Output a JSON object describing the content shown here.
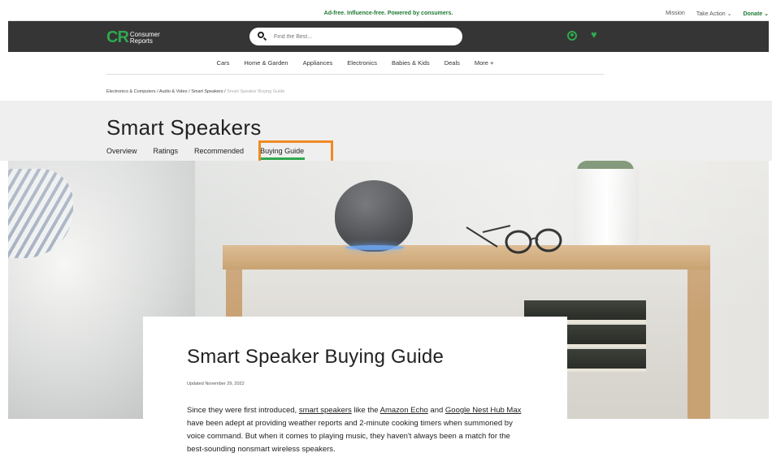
{
  "promo": {
    "text": "Ad-free. Influence-free. Powered by consumers.",
    "links": [
      {
        "label": "Mission"
      },
      {
        "label": "Take Action ⌄"
      },
      {
        "label": "Donate ⌄"
      }
    ]
  },
  "header": {
    "logo_mark": "CR",
    "logo_line1": "Consumer",
    "logo_line2": "Reports",
    "search_placeholder": "Find the Best...",
    "icons": [
      "user-icon",
      "heart-icon"
    ],
    "accent_color": "#2fa84f"
  },
  "catnav": {
    "items": [
      "Cars",
      "Home & Garden",
      "Appliances",
      "Electronics",
      "Babies & Kids",
      "Deals",
      "More +"
    ]
  },
  "breadcrumb": {
    "items": [
      "Electronics & Computers",
      "Audio & Video",
      "Smart Speakers",
      "Smart Speaker Buying Guide"
    ],
    "separator": "/"
  },
  "page": {
    "title": "Smart Speakers",
    "tabs": [
      "Overview",
      "Ratings",
      "Recommended",
      "Buying Guide"
    ],
    "selected_tab": "Buying Guide"
  },
  "article": {
    "title": "Smart Speaker Buying Guide",
    "updated": "Updated November 29, 2022",
    "p1_a": "Since they were first introduced, ",
    "link1": "smart speakers",
    "p1_b": " like the ",
    "link2": "Amazon Echo",
    "p1_c": " and ",
    "link3": "Google Nest Hub Max",
    "p1_d": " have been adept at providing weather reports and 2-minute cooking timers when summoned by voice command. But when it comes to playing music, they haven't always been a match for the best-sounding nonsmart wireless speakers."
  }
}
